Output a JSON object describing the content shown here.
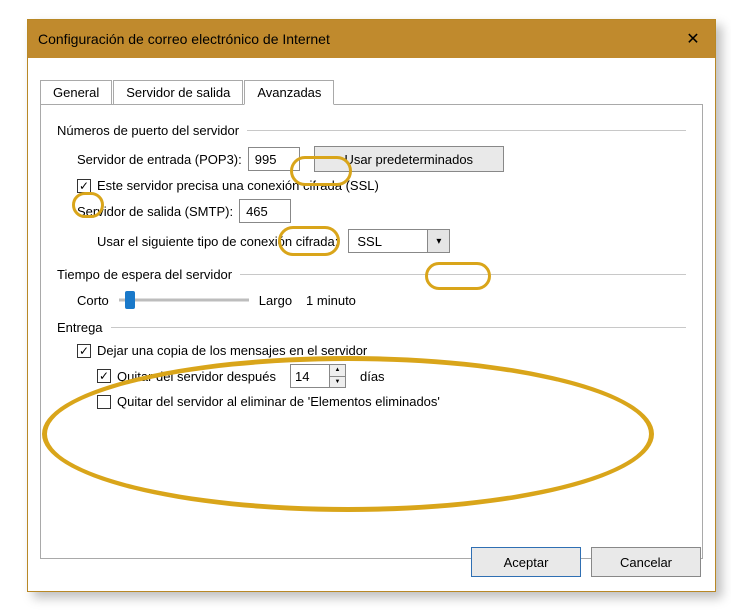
{
  "window": {
    "title": "Configuración de correo electrónico de Internet"
  },
  "tabs": {
    "general": "General",
    "outgoing": "Servidor de salida",
    "advanced": "Avanzadas"
  },
  "ports": {
    "group": "Números de puerto del servidor",
    "incoming_label": "Servidor de entrada (POP3):",
    "incoming_value": "995",
    "defaults_btn": "Usar predeterminados",
    "ssl_checkbox": "Este servidor precisa una conexión cifrada (SSL)",
    "outgoing_label": "Servidor de salida (SMTP):",
    "outgoing_value": "465",
    "enc_label": "Usar el siguiente tipo de conexión cifrada:",
    "enc_value": "SSL"
  },
  "timeout": {
    "group": "Tiempo de espera del servidor",
    "short": "Corto",
    "long": "Largo",
    "value": "1 minuto"
  },
  "delivery": {
    "group": "Entrega",
    "leave_copy": "Dejar una copia de los mensajes en el servidor",
    "remove_after": "Quitar del servidor después",
    "days_value": "14",
    "days_label": "días",
    "remove_on_delete": "Quitar del servidor al eliminar de 'Elementos eliminados'"
  },
  "buttons": {
    "ok": "Aceptar",
    "cancel": "Cancelar"
  }
}
